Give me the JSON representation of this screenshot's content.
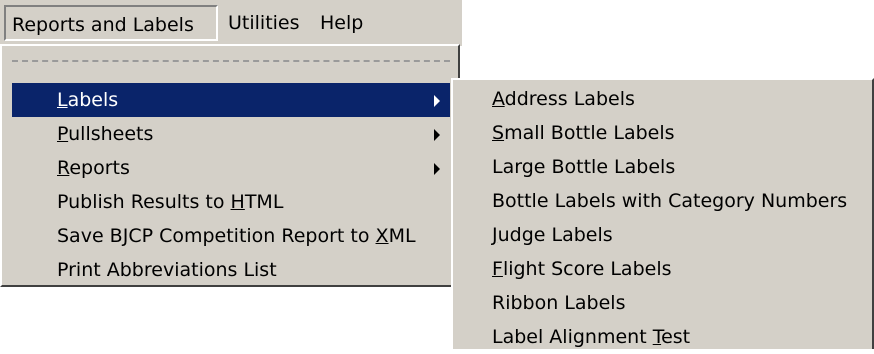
{
  "menubar": {
    "items": [
      {
        "label": "Reports and Labels",
        "accel": "",
        "state": "open"
      },
      {
        "label": "Utilities",
        "accel": ""
      },
      {
        "label": "Help",
        "accel": ""
      }
    ]
  },
  "dropdown": {
    "items": [
      {
        "label": "Labels",
        "accel": "L",
        "has_submenu": true,
        "highlighted": true
      },
      {
        "label": "Pullsheets",
        "accel": "P",
        "has_submenu": true
      },
      {
        "label": "Reports",
        "accel": "R",
        "has_submenu": true
      },
      {
        "label": "Publish Results to HTML",
        "accel": "H",
        "has_submenu": false
      },
      {
        "label": "Save BJCP Competition Report to XML",
        "accel": "X",
        "has_submenu": false
      },
      {
        "label": "Print Abbreviations List",
        "accel": "",
        "has_submenu": false
      }
    ]
  },
  "submenu": {
    "items": [
      {
        "label": "Address Labels",
        "accel": "A"
      },
      {
        "label": "Small Bottle Labels",
        "accel": "S"
      },
      {
        "label": "Large Bottle Labels",
        "accel": ""
      },
      {
        "label": "Bottle Labels with Category Numbers",
        "accel": ""
      },
      {
        "label": "Judge Labels",
        "accel": "J"
      },
      {
        "label": "Flight Score Labels",
        "accel": "F"
      },
      {
        "label": "Ribbon Labels",
        "accel": ""
      },
      {
        "label": "Label Alignment Test",
        "accel": "T"
      }
    ]
  },
  "colors": {
    "menu_face": "#d4d0c8",
    "highlight": "#0a246a",
    "highlight_text": "#ffffff"
  }
}
